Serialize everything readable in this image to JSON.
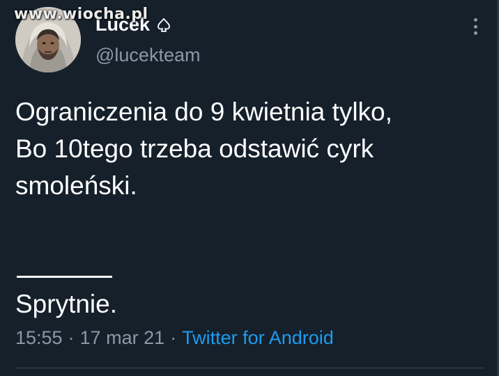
{
  "watermark": "www.wiocha.pl",
  "profile": {
    "display_name": "Lucek",
    "verified_icon": "spade-icon",
    "handle": "@lucekteam"
  },
  "tweet": {
    "text": "Ograniczenia do 9 kwietnia tylko,\nBo 10tego trzeba odstawić cyrk\nsmoleński.",
    "footer_text": "Sprytnie."
  },
  "meta": {
    "time": "15:55",
    "date": "17 mar 21",
    "separator": "·",
    "source": "Twitter for Android"
  },
  "colors": {
    "background": "#15202b",
    "secondary_text": "#8b98a5",
    "link": "#1d9bf0"
  }
}
